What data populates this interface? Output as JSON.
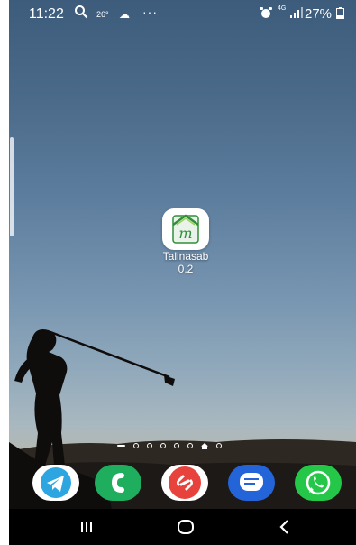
{
  "status_bar": {
    "time": "11:22",
    "temperature": "26°",
    "more": "···",
    "network": "4G",
    "battery": "27%",
    "icons": [
      "search-icon",
      "weather-icon",
      "alarm-icon",
      "signal-icon",
      "battery-icon"
    ]
  },
  "home": {
    "app": {
      "name_line1": "Talinasab",
      "name_line2": "0.2",
      "icon_letters": "m",
      "icon": "talinasab-app-icon"
    }
  },
  "page_indicator": {
    "pages": 6,
    "current": "home"
  },
  "dock": {
    "apps": [
      {
        "name": "telegram",
        "icon": "telegram-icon",
        "color": "#2ca5e0"
      },
      {
        "name": "phone",
        "icon": "phone-icon",
        "color": "#1fae5e"
      },
      {
        "name": "shazam",
        "icon": "shazam-icon",
        "color": "#e8423c"
      },
      {
        "name": "messages",
        "icon": "messages-icon",
        "color": "#2364d8"
      },
      {
        "name": "whatsapp",
        "icon": "whatsapp-icon",
        "color": "#25c748"
      }
    ]
  },
  "nav_bar": {
    "buttons": [
      "recents-icon",
      "home-icon",
      "back-icon"
    ]
  }
}
